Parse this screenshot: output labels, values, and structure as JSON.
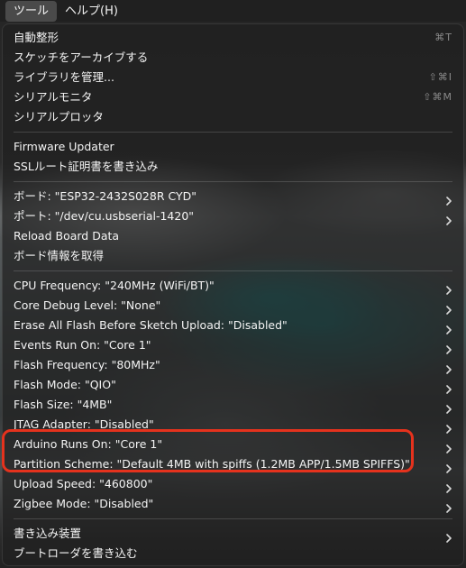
{
  "menubar": {
    "items": [
      {
        "label": "ツール",
        "active": true
      },
      {
        "label": "ヘルプ(H)",
        "active": false
      }
    ]
  },
  "menu": {
    "groups": [
      [
        {
          "label": "自動整形",
          "shortcut": "⌘T"
        },
        {
          "label": "スケッチをアーカイブする"
        },
        {
          "label": "ライブラリを管理...",
          "shortcut": "⇧⌘I"
        },
        {
          "label": "シリアルモニタ",
          "shortcut": "⇧⌘M"
        },
        {
          "label": "シリアルプロッタ"
        }
      ],
      [
        {
          "label": "Firmware Updater"
        },
        {
          "label": "SSLルート証明書を書き込み"
        }
      ],
      [
        {
          "label": "ボード: \"ESP32-2432S028R CYD\"",
          "submenu": true
        },
        {
          "label": "ポート: \"/dev/cu.usbserial-1420\"",
          "submenu": true
        },
        {
          "label": "Reload Board Data"
        },
        {
          "label": "ボード情報を取得"
        }
      ],
      [
        {
          "label": "CPU Frequency: \"240MHz (WiFi/BT)\"",
          "submenu": true
        },
        {
          "label": "Core Debug Level: \"None\"",
          "submenu": true
        },
        {
          "label": "Erase All Flash Before Sketch Upload: \"Disabled\"",
          "submenu": true
        },
        {
          "label": "Events Run On: \"Core 1\"",
          "submenu": true
        },
        {
          "label": "Flash Frequency: \"80MHz\"",
          "submenu": true
        },
        {
          "label": "Flash Mode: \"QIO\"",
          "submenu": true
        },
        {
          "label": "Flash Size: \"4MB\"",
          "submenu": true
        },
        {
          "label": "JTAG Adapter: \"Disabled\"",
          "submenu": true
        },
        {
          "label": "Arduino Runs On: \"Core 1\"",
          "submenu": true
        },
        {
          "label": "Partition Scheme: \"Default 4MB with spiffs (1.2MB APP/1.5MB SPIFFS)\"",
          "submenu": true
        },
        {
          "label": "Upload Speed: \"460800\"",
          "submenu": true
        },
        {
          "label": "Zigbee Mode: \"Disabled\"",
          "submenu": true
        }
      ],
      [
        {
          "label": "書き込み装置",
          "submenu": true
        },
        {
          "label": "ブートローダを書き込む"
        }
      ]
    ]
  },
  "colors": {
    "highlight": "#e5321d",
    "menubar_active": "#4a4a4a"
  }
}
